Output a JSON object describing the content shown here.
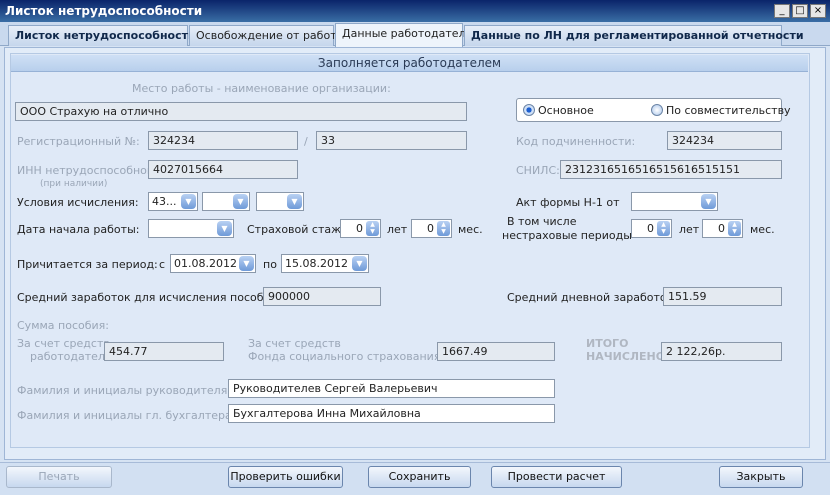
{
  "window": {
    "title": "Листок нетрудоспособности"
  },
  "tabs": [
    {
      "label": "Листок нетрудоспособности"
    },
    {
      "label": "Освобождение от работы"
    },
    {
      "label": "Данные работодателя"
    },
    {
      "label": "Данные по ЛН для регламентированной отчетности"
    }
  ],
  "section": {
    "header": "Заполняется работодателем"
  },
  "workplace": {
    "label": "Место работы - наименование организации:",
    "value": "ООО Страхую на отлично"
  },
  "employment": {
    "main_label": "Основное",
    "part_time_label": "По совместительству",
    "selected": "main"
  },
  "reg": {
    "label": "Регистрационный №:",
    "value1": "324234",
    "separator": "/",
    "value2": "33"
  },
  "subordination": {
    "label": "Код подчиненности:",
    "value": "324234"
  },
  "inn": {
    "label": "ИНН нетрудоспособного:",
    "note": "(при наличии)",
    "value": "4027015664"
  },
  "snils": {
    "label": "СНИЛС:",
    "value": "2312316516516515616515151"
  },
  "calc": {
    "label": "Условия исчисления:",
    "value1": "43...",
    "value2": "",
    "value3": ""
  },
  "act": {
    "label": "Акт формы Н-1 от",
    "value": ""
  },
  "start": {
    "label": "Дата начала работы:",
    "value": ""
  },
  "insurance": {
    "label": "Страховой стаж:",
    "years": "0",
    "years_label": "лет",
    "months": "0",
    "months_label": "мес."
  },
  "noninsurance": {
    "label1": "В том числе",
    "label2": "нестраховые периоды",
    "years": "0",
    "years_label": "лет",
    "months": "0",
    "months_label": "мес."
  },
  "period": {
    "label": "Причитается за период:",
    "from_label": "с",
    "from": "01.08.2012",
    "to_label": "по",
    "to": "15.08.2012"
  },
  "avg_earnings": {
    "label": "Средний заработок для исчисления пособия:",
    "value": "900000"
  },
  "daily_earnings": {
    "label": "Средний дневной заработок:",
    "value": "151.59"
  },
  "benefit": {
    "label": "Сумма пособия:",
    "employer_label1": "За счет средств",
    "employer_label2": "работодателя:",
    "employer_value": "454.77",
    "fss_label1": "За счет средств",
    "fss_label2": "Фонда социального страхования РФ:",
    "fss_value": "1667.49",
    "total_label1": "ИТОГО",
    "total_label2": "НАЧИСЛЕНО:",
    "total_value": "2 122,26р."
  },
  "manager": {
    "label": "Фамилия и инициалы руководителя:",
    "value": "Руководителев Сергей Валерьевич"
  },
  "accountant": {
    "label": "Фамилия и инициалы гл. бухгалтера:",
    "value": "Бухгалтерова Инна Михайловна"
  },
  "buttons": {
    "print": "Печать",
    "check": "Проверить ошибки",
    "save": "Сохранить",
    "calculate": "Провести расчет",
    "close": "Закрыть"
  }
}
